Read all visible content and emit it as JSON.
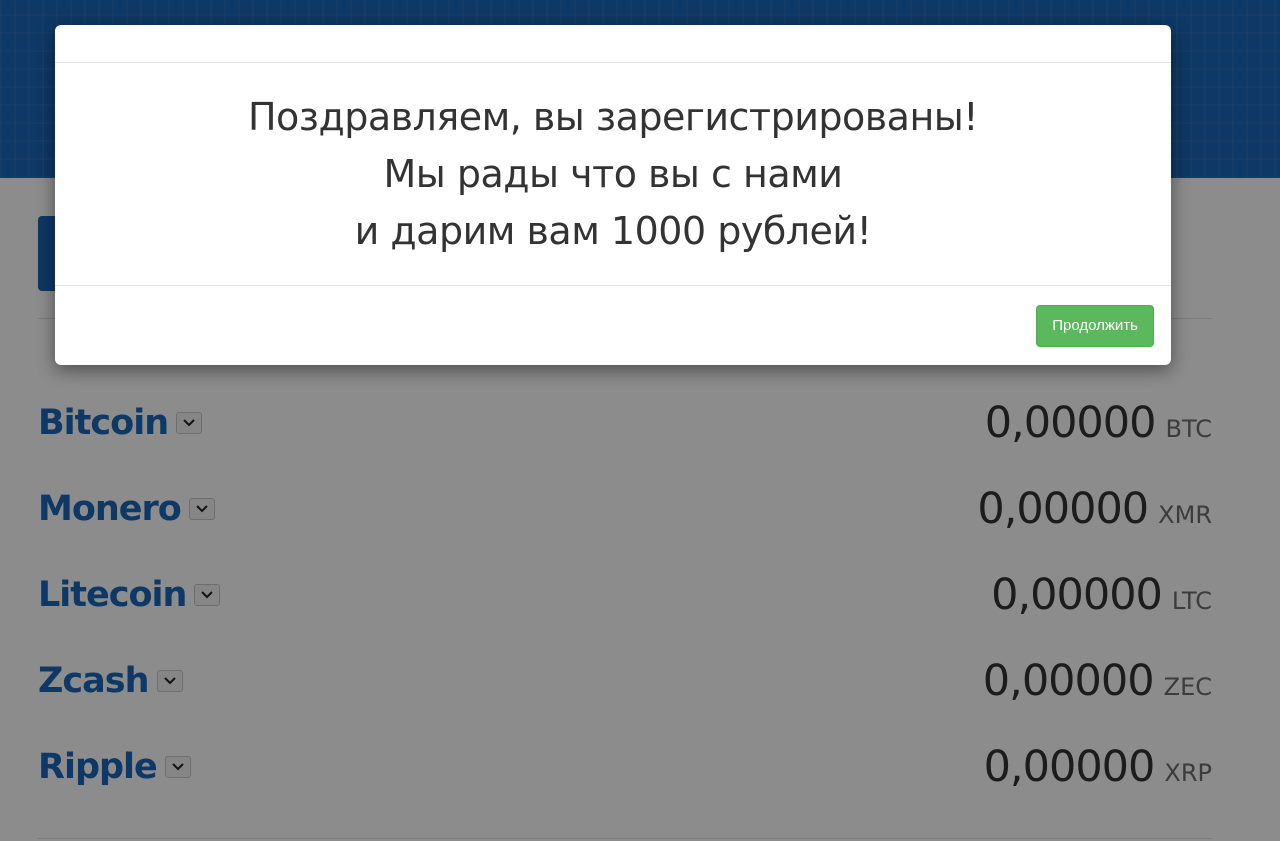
{
  "modal": {
    "message_lines": [
      "Поздравляем, вы зарегистрированы!",
      "Мы рады что вы с нами",
      "и дарим вам 1000 рублей!"
    ],
    "continue_label": "Продолжить"
  },
  "wallets": [
    {
      "name": "Bitcoin",
      "amount": "0,00000",
      "ticker": "BTC"
    },
    {
      "name": "Monero",
      "amount": "0,00000",
      "ticker": "XMR"
    },
    {
      "name": "Litecoin",
      "amount": "0,00000",
      "ticker": "LTC"
    },
    {
      "name": "Zcash",
      "amount": "0,00000",
      "ticker": "ZEC"
    },
    {
      "name": "Ripple",
      "amount": "0,00000",
      "ticker": "XRP"
    }
  ],
  "icons": {
    "toggle": "chevron-down-icon"
  },
  "colors": {
    "brand_blue": "#1a66b8",
    "success_green": "#5cb85c",
    "backdrop": "rgba(0,0,0,0.45)"
  }
}
